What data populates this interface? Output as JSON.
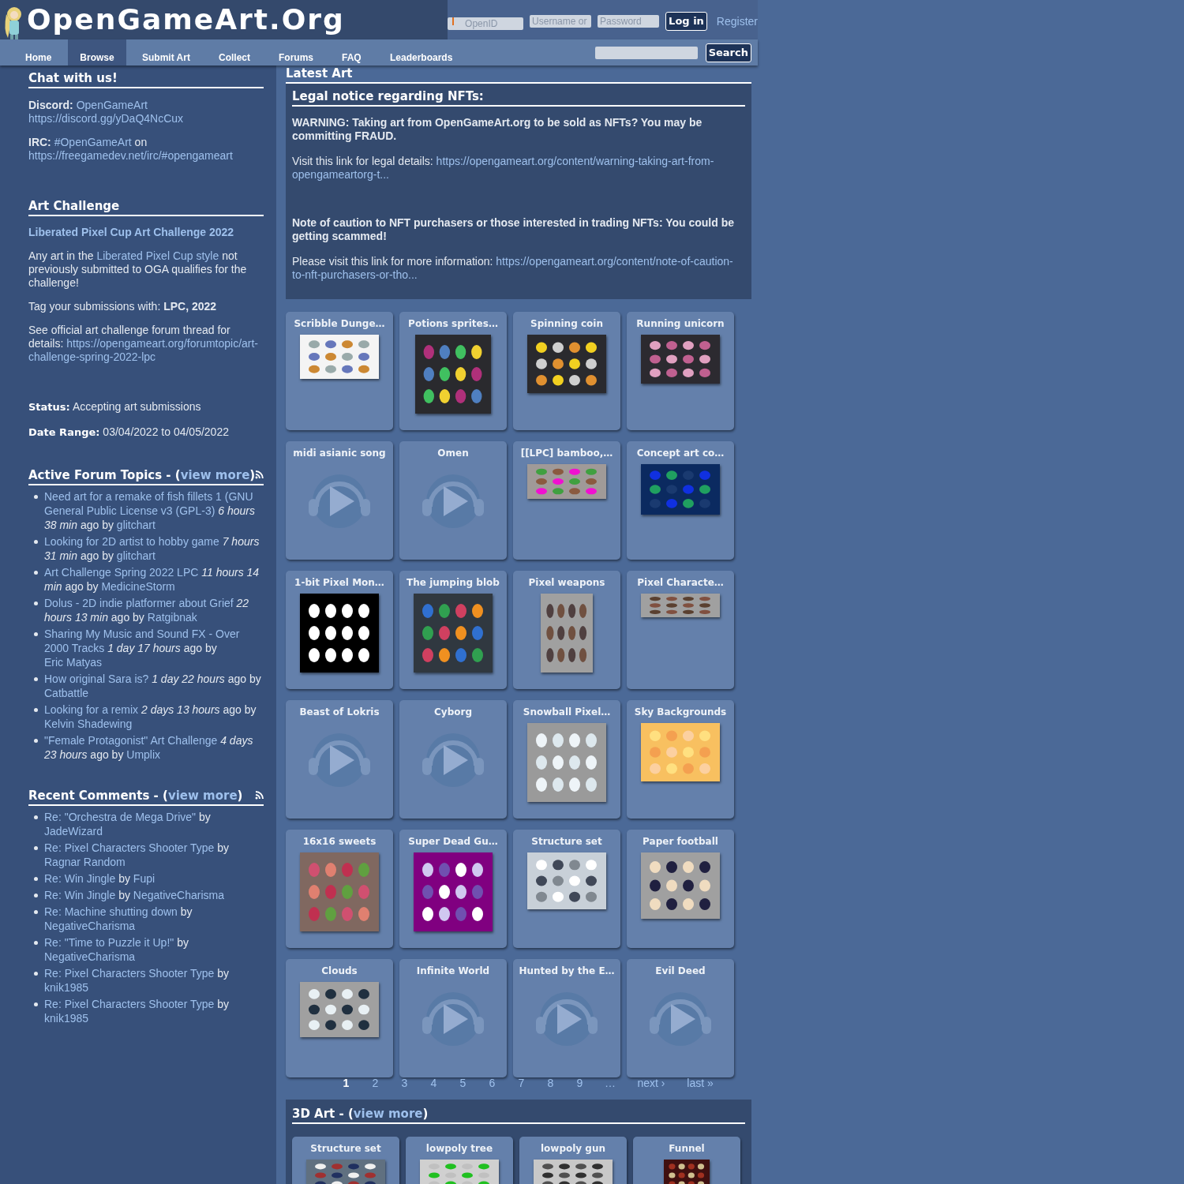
{
  "header": {
    "logo_text": "OpenGameArt.Org",
    "openid_placeholder": "OpenID",
    "username_placeholder": "Username or",
    "password_placeholder": "Password",
    "login_button": "Log in",
    "register_link": "Register"
  },
  "nav": {
    "items": [
      {
        "label": "Home",
        "selected": false
      },
      {
        "label": "Browse",
        "selected": true
      },
      {
        "label": "Submit Art",
        "selected": false
      },
      {
        "label": "Collect",
        "selected": false
      },
      {
        "label": "Forums",
        "selected": false
      },
      {
        "label": "FAQ",
        "selected": false
      },
      {
        "label": "Leaderboards",
        "selected": false
      }
    ],
    "search_button": "Search"
  },
  "sidebar": {
    "chat": {
      "heading": "Chat with us!",
      "paragraphs": [
        [
          {
            "kind": "bold",
            "text": "Discord: "
          },
          {
            "kind": "link",
            "text": "OpenGameArt"
          },
          {
            "kind": "break"
          },
          {
            "kind": "link",
            "text": "https://discord.gg/yDaQ4NcCux"
          }
        ],
        [
          {
            "kind": "bold",
            "text": "IRC: "
          },
          {
            "kind": "link",
            "text": "#OpenGameArt"
          },
          {
            "kind": "text",
            "text": " on "
          },
          {
            "kind": "link",
            "text": "https://freegamedev.net/irc/#opengameart"
          }
        ]
      ]
    },
    "challenge": {
      "heading": "Art Challenge",
      "title": "Liberated Pixel Cup Art Challenge 2022",
      "paragraphs": [
        [
          {
            "kind": "text",
            "text": "Any art in the "
          },
          {
            "kind": "link",
            "text": "Liberated Pixel Cup style"
          },
          {
            "kind": "text",
            "text": " not previously submitted to OGA qualifies for the challenge!"
          }
        ],
        [
          {
            "kind": "text",
            "text": "Tag your submissions with: "
          },
          {
            "kind": "bold",
            "text": "LPC, 2022"
          }
        ],
        [
          {
            "kind": "text",
            "text": "See official art challenge forum thread for details: "
          },
          {
            "kind": "link",
            "text": "https://opengameart.org/forumtopic/art-challenge-spring-2022-lpc"
          }
        ]
      ],
      "status_label": "Status:",
      "status": "Accepting art submissions",
      "date_label": "Date Range:",
      "date_range": "03/04/2022 to 04/05/2022"
    },
    "forum": {
      "heading": [
        {
          "kind": "text",
          "text": "Active Forum Topics - ("
        },
        {
          "kind": "link",
          "text": "view more"
        },
        {
          "kind": "text",
          "text": ")"
        }
      ],
      "items": [
        [
          {
            "kind": "link",
            "text": "Need art for a remake of fish fillets 1 (GNU General Public License v3 (GPL-3)"
          },
          {
            "kind": "italic",
            "text": " 6 hours 38 min"
          },
          {
            "kind": "text",
            "text": " ago by "
          },
          {
            "kind": "link",
            "text": "glitchart"
          }
        ],
        [
          {
            "kind": "link",
            "text": "Looking for 2D artist to hobby game"
          },
          {
            "kind": "italic",
            "text": " 7 hours 31 min"
          },
          {
            "kind": "text",
            "text": " ago by "
          },
          {
            "kind": "link",
            "text": "glitchart"
          }
        ],
        [
          {
            "kind": "link",
            "text": "Art Challenge Spring 2022 LPC"
          },
          {
            "kind": "italic",
            "text": " 11 hours 14 min"
          },
          {
            "kind": "text",
            "text": " ago by "
          },
          {
            "kind": "link",
            "text": "MedicineStorm"
          }
        ],
        [
          {
            "kind": "link",
            "text": "Dolus - 2D indie platformer about Grief"
          },
          {
            "kind": "italic",
            "text": " 22 hours 13 min"
          },
          {
            "kind": "text",
            "text": " ago by "
          },
          {
            "kind": "link",
            "text": "Ratgibnak"
          }
        ],
        [
          {
            "kind": "link",
            "text": "Sharing My Music and Sound FX - Over 2000 Tracks"
          },
          {
            "kind": "italic",
            "text": " 1 day 17 hours"
          },
          {
            "kind": "text",
            "text": " ago by "
          },
          {
            "kind": "link",
            "text": "Eric Matyas"
          }
        ],
        [
          {
            "kind": "link",
            "text": "How original Sara is?"
          },
          {
            "kind": "italic",
            "text": " 1 day 22 hours"
          },
          {
            "kind": "text",
            "text": " ago by "
          },
          {
            "kind": "link",
            "text": "Catbattle"
          }
        ],
        [
          {
            "kind": "link",
            "text": "Looking for a remix"
          },
          {
            "kind": "italic",
            "text": " 2 days 13 hours"
          },
          {
            "kind": "text",
            "text": " ago by "
          },
          {
            "kind": "link",
            "text": "Kelvin Shadewing"
          }
        ],
        [
          {
            "kind": "link",
            "text": "\"Female Protagonist\" Art Challenge"
          },
          {
            "kind": "italic",
            "text": " 4 days 23 hours"
          },
          {
            "kind": "text",
            "text": " ago by "
          },
          {
            "kind": "link",
            "text": "Umplix"
          }
        ]
      ]
    },
    "comments": {
      "heading": [
        {
          "kind": "text",
          "text": "Recent Comments - ("
        },
        {
          "kind": "link",
          "text": "view more"
        },
        {
          "kind": "text",
          "text": ")"
        }
      ],
      "items": [
        [
          {
            "kind": "link",
            "text": "Re: \"Orchestra de Mega Drive\""
          },
          {
            "kind": "text",
            "text": " by "
          },
          {
            "kind": "link",
            "text": "JadeWizard"
          }
        ],
        [
          {
            "kind": "link",
            "text": "Re: Pixel Characters Shooter Type"
          },
          {
            "kind": "text",
            "text": " by "
          },
          {
            "kind": "link",
            "text": "Ragnar Random"
          }
        ],
        [
          {
            "kind": "link",
            "text": "Re: Win Jingle"
          },
          {
            "kind": "text",
            "text": " by "
          },
          {
            "kind": "link",
            "text": "Fupi"
          }
        ],
        [
          {
            "kind": "link",
            "text": "Re: Win Jingle"
          },
          {
            "kind": "text",
            "text": " by "
          },
          {
            "kind": "link",
            "text": "NegativeCharisma"
          }
        ],
        [
          {
            "kind": "link",
            "text": "Re: Machine shutting down"
          },
          {
            "kind": "text",
            "text": " by "
          },
          {
            "kind": "link",
            "text": "NegativeCharisma"
          }
        ],
        [
          {
            "kind": "link",
            "text": "Re: \"Time to Puzzle it Up!\""
          },
          {
            "kind": "text",
            "text": " by "
          },
          {
            "kind": "link",
            "text": "NegativeCharisma"
          }
        ],
        [
          {
            "kind": "link",
            "text": "Re: Pixel Characters Shooter Type"
          },
          {
            "kind": "text",
            "text": " by "
          },
          {
            "kind": "link",
            "text": "knik1985"
          }
        ],
        [
          {
            "kind": "link",
            "text": "Re: Pixel Characters Shooter Type"
          },
          {
            "kind": "text",
            "text": " by "
          },
          {
            "kind": "link",
            "text": "knik1985"
          }
        ]
      ]
    }
  },
  "main": {
    "heading": "Latest Art",
    "notice": {
      "heading": "Legal notice regarding NFTs:",
      "paragraphs": [
        [
          {
            "kind": "bold",
            "text": "WARNING: Taking art from OpenGameArt.org to be sold as NFTs? You may be committing FRAUD."
          }
        ],
        [
          {
            "kind": "text",
            "text": "Visit this link for legal details: "
          },
          {
            "kind": "link",
            "text": "https://opengameart.org/content/warning-taking-art-from-opengameartorg-t..."
          }
        ],
        [
          {
            "kind": "bold",
            "text": "Note of caution to NFT purchasers or those interested in trading NFTs: You could be getting scammed!"
          }
        ],
        [
          {
            "kind": "text",
            "text": "Please visit this link for more information: "
          },
          {
            "kind": "link",
            "text": "https://opengameart.org/content/note-of-caution-to-nft-purchasers-or-tho..."
          }
        ]
      ]
    },
    "tiles": [
      {
        "title": "Scribble Dunge…"
      },
      {
        "title": "Potions sprites…"
      },
      {
        "title": "Spinning coin"
      },
      {
        "title": "Running unicorn"
      },
      {
        "title": "midi asianic song",
        "kind": "audio"
      },
      {
        "title": "Omen",
        "kind": "audio"
      },
      {
        "title": "[[LPC] bamboo,…"
      },
      {
        "title": "Concept art co…"
      },
      {
        "title": "1-bit Pixel Mon…"
      },
      {
        "title": "The jumping blob"
      },
      {
        "title": "Pixel weapons"
      },
      {
        "title": "Pixel Characte…"
      },
      {
        "title": "Beast of Lokris",
        "kind": "audio"
      },
      {
        "title": "Cyborg",
        "kind": "audio"
      },
      {
        "title": "Snowball Pixel…"
      },
      {
        "title": "Sky Backgrounds"
      },
      {
        "title": "16x16 sweets"
      },
      {
        "title": "Super Dead Gu…"
      },
      {
        "title": "Structure set"
      },
      {
        "title": "Paper football"
      },
      {
        "title": "Clouds"
      },
      {
        "title": "Infinite World",
        "kind": "audio"
      },
      {
        "title": "Hunted by the E…",
        "kind": "audio"
      },
      {
        "title": "Evil Deed",
        "kind": "audio"
      }
    ],
    "pager": [
      {
        "label": "1",
        "selected": true
      },
      {
        "label": "2",
        "selected": false
      },
      {
        "label": "3",
        "selected": false
      },
      {
        "label": "4",
        "selected": false
      },
      {
        "label": "5",
        "selected": false
      },
      {
        "label": "6",
        "selected": false
      },
      {
        "label": "7",
        "selected": false
      },
      {
        "label": "8",
        "selected": false
      },
      {
        "label": "9",
        "selected": false
      },
      {
        "label": "…",
        "selected": false
      },
      {
        "label": "next ›",
        "selected": false
      },
      {
        "label": "last »",
        "selected": false
      }
    ],
    "art3d": {
      "heading": [
        {
          "kind": "text",
          "text": "3D Art - ("
        },
        {
          "kind": "link",
          "text": "view more"
        },
        {
          "kind": "text",
          "text": ")"
        }
      ],
      "tiles": [
        {
          "title": "Structure set"
        },
        {
          "title": "lowpoly tree"
        },
        {
          "title": "lowpoly gun"
        },
        {
          "title": "Funnel"
        }
      ]
    }
  }
}
